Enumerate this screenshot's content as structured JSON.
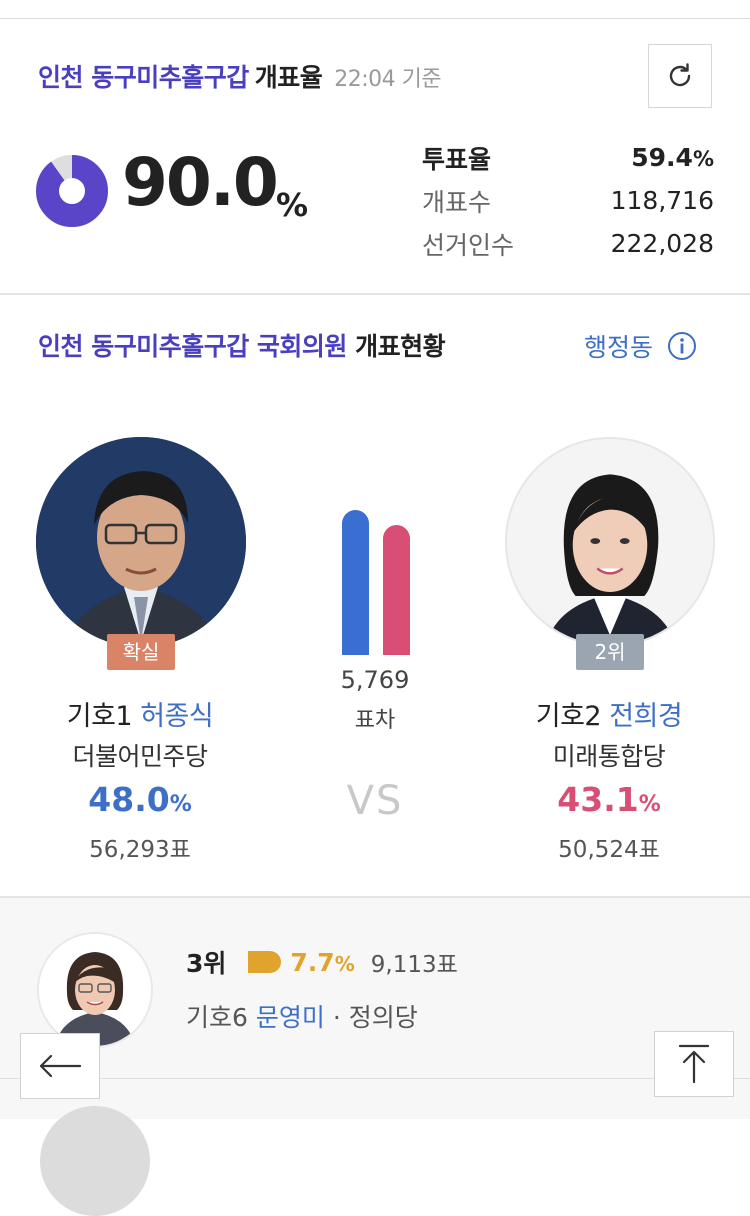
{
  "turnout_header": {
    "region": "인천 동구미추홀구갑",
    "label": "개표율",
    "time": "22:04 기준",
    "count_rate": "90.0",
    "count_rate_unit": "%",
    "count_rate_value": 90.0
  },
  "stats": [
    {
      "label": "투표율",
      "value": "59.4",
      "unit": "%"
    },
    {
      "label": "개표수",
      "value": "118,716",
      "unit": ""
    },
    {
      "label": "선거인수",
      "value": "222,028",
      "unit": ""
    }
  ],
  "results_header": {
    "region": "인천 동구미추홀구갑 국회의원",
    "label": " 개표현황",
    "dong_link": "행정동"
  },
  "candidates": [
    {
      "badge": "확실",
      "number_label": "기호1",
      "name": "허종식",
      "party": "더불어민주당",
      "pct": "48.0",
      "pct_unit": "%",
      "votes": "56,293표",
      "color": "#3d6fc6"
    },
    {
      "badge": "2위",
      "number_label": "기호2",
      "name": "전희경",
      "party": "미래통합당",
      "pct": "43.1",
      "pct_unit": "%",
      "votes": "50,524표",
      "color": "#d94f74"
    }
  ],
  "difference": {
    "value": "5,769",
    "label": "표차"
  },
  "vs_label": "VS",
  "others": [
    {
      "rank": "3위",
      "pct": "7.7",
      "pct_unit": "%",
      "votes": "9,113표",
      "number_label": "기호6",
      "name": "문영미",
      "party_sep": " · ",
      "party": "정의당",
      "color": "#e0a32c"
    }
  ],
  "colors": {
    "accent_purple": "#4a3fbf",
    "link_blue": "#3d6fc6",
    "badge_confirmed": "#d98466",
    "badge_rank": "#9aa5b1"
  }
}
